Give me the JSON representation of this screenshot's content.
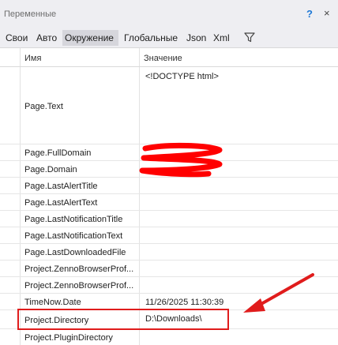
{
  "panel": {
    "title": "Переменные",
    "help": "?",
    "close": "×"
  },
  "tabs": [
    {
      "label": "Свои",
      "active": false
    },
    {
      "label": "Авто",
      "active": false
    },
    {
      "label": "Окружение",
      "active": true
    },
    {
      "label": "Глобальные",
      "active": false
    },
    {
      "label": "Json",
      "active": false
    },
    {
      "label": "Xml",
      "active": false
    }
  ],
  "icons": {
    "filter": "filter-icon"
  },
  "columns": {
    "name": "Имя",
    "value": "Значение"
  },
  "rows": [
    {
      "name": "Page.Text",
      "value": "<!DOCTYPE html>"
    },
    {
      "name": "Page.FullDomain",
      "value": ""
    },
    {
      "name": "Page.Domain",
      "value": ""
    },
    {
      "name": "Page.LastAlertTitle",
      "value": ""
    },
    {
      "name": "Page.LastAlertText",
      "value": ""
    },
    {
      "name": "Page.LastNotificationTitle",
      "value": ""
    },
    {
      "name": "Page.LastNotificationText",
      "value": ""
    },
    {
      "name": "Page.LastDownloadedFile",
      "value": ""
    },
    {
      "name": "Project.ZennoBrowserProf...",
      "value": ""
    },
    {
      "name": "Project.ZennoBrowserProf...",
      "value": ""
    },
    {
      "name": "TimeNow.Date",
      "value": "11/26/2025 11:30:39"
    },
    {
      "name": "Project.Directory",
      "value": "D:\\Downloads\\"
    },
    {
      "name": "Project.PluginDirectory",
      "value": ""
    }
  ],
  "colors": {
    "annotation": "#e01c1c",
    "scribble": "#ff0000",
    "accent": "#1e78d6"
  }
}
